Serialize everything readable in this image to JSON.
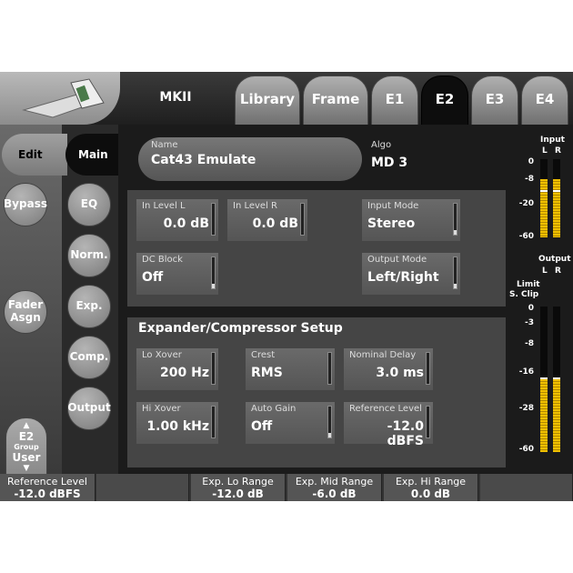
{
  "header": {
    "mkii": "MKII",
    "tabs": [
      "Library",
      "Frame",
      "E1",
      "E2",
      "E3",
      "E4"
    ]
  },
  "left": {
    "edit": "Edit",
    "bypass": "Bypass",
    "fader_asgn": "Fader\nAsgn",
    "group_label": "Group",
    "group_num": "E2",
    "group_value": "User"
  },
  "nav": {
    "main": "Main",
    "eq": "EQ",
    "norm": "Norm.",
    "exp": "Exp.",
    "comp": "Comp.",
    "output": "Output"
  },
  "preset": {
    "name_label": "Name",
    "name": "Cat43 Emulate",
    "algo_label": "Algo",
    "algo": "MD 3"
  },
  "inputs": {
    "in_level_l_label": "In Level L",
    "in_level_l": "0.0 dB",
    "in_level_r_label": "In Level R",
    "in_level_r": "0.0 dB",
    "input_mode_label": "Input Mode",
    "input_mode": "Stereo",
    "dc_block_label": "DC Block",
    "dc_block": "Off",
    "output_mode_label": "Output Mode",
    "output_mode": "Left/Right"
  },
  "setup": {
    "title": "Expander/Compressor Setup",
    "lo_xover_label": "Lo Xover",
    "lo_xover": "200 Hz",
    "crest_label": "Crest",
    "crest": "RMS",
    "nominal_delay_label": "Nominal Delay",
    "nominal_delay": "3.0 ms",
    "hi_xover_label": "Hi Xover",
    "hi_xover": "1.00 kHz",
    "auto_gain_label": "Auto Gain",
    "auto_gain": "Off",
    "reference_level_label": "Reference Level",
    "reference_level": "-12.0 dBFS"
  },
  "meters": {
    "input_title": "Input",
    "output_title": "Output",
    "l": "L",
    "r": "R",
    "limit": "Limit",
    "sclip": "S. Clip",
    "input_scale": [
      "0",
      "-8",
      "-20",
      "-60"
    ],
    "output_scale": [
      "0",
      "-3",
      "-8",
      "-16",
      "-28",
      "-60"
    ],
    "input_level_l": 0.74,
    "input_level_r": 0.74,
    "output_level_l": 0.5,
    "output_level_r": 0.5
  },
  "bottom": [
    {
      "label": "Reference Level",
      "value": "-12.0 dBFS"
    },
    {
      "label": "",
      "value": ""
    },
    {
      "label": "Exp. Lo Range",
      "value": "-12.0 dB"
    },
    {
      "label": "Exp. Mid Range",
      "value": "-6.0 dB"
    },
    {
      "label": "Exp. Hi Range",
      "value": "0.0 dB"
    },
    {
      "label": "",
      "value": ""
    }
  ]
}
